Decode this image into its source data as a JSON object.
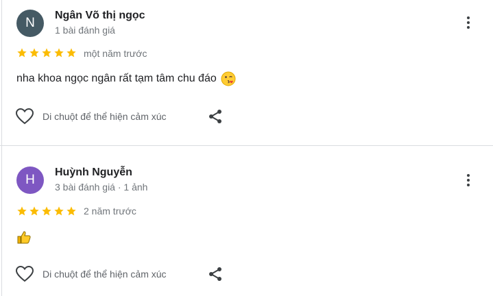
{
  "reviews": [
    {
      "avatar_letter": "N",
      "avatar_color": "#455a64",
      "name": "Ngân Võ thị ngọc",
      "meta": "1 bài đánh giá",
      "stars": 5,
      "time": "một năm trước",
      "text": "nha khoa ngọc ngân rất tạm tâm chu đáo",
      "emoji_icon": "kissing-wink-face-icon",
      "like_label": "Di chuột để thể hiện cảm xúc"
    },
    {
      "avatar_letter": "H",
      "avatar_color": "#7e57c2",
      "name": "Huỳnh Nguyễn",
      "meta": "3 bài đánh giá · 1 ảnh",
      "stars": 5,
      "time": "2 năm trước",
      "text": "",
      "emoji_icon": "thumbs-up-icon",
      "like_label": "Di chuột để thể hiện cảm xúc"
    }
  ],
  "colors": {
    "star": "#fbbc04",
    "divider": "#dadce0",
    "icon": "#3c4043"
  }
}
